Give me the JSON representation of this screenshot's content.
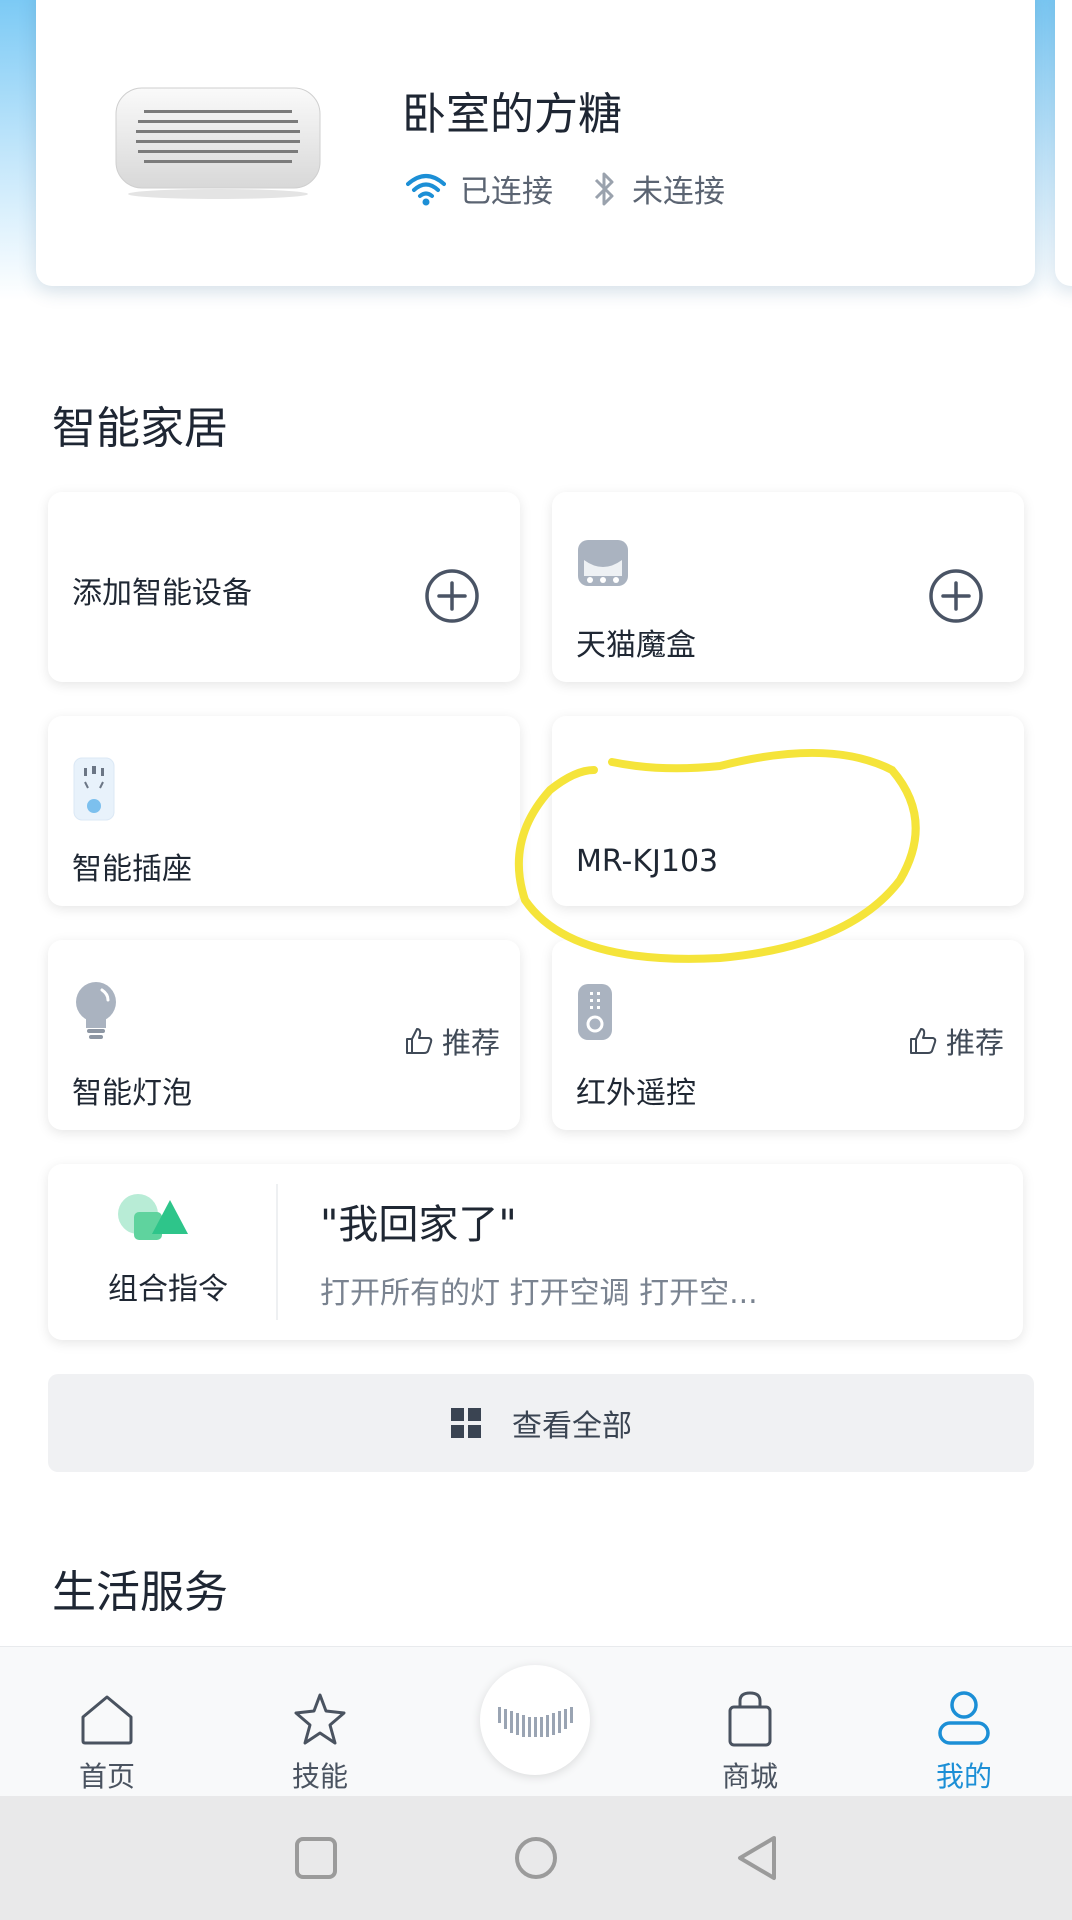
{
  "device": {
    "name": "卧室的方糖",
    "wifi_status": "已连接",
    "bluetooth_status": "未连接"
  },
  "smart_home": {
    "title": "智能家居",
    "tiles": [
      {
        "label": "添加智能设备"
      },
      {
        "label": "天猫魔盒"
      },
      {
        "label": "智能插座"
      },
      {
        "label": "MR-KJ103"
      },
      {
        "label": "智能灯泡",
        "badge": "推荐"
      },
      {
        "label": "红外遥控",
        "badge": "推荐"
      }
    ],
    "combo": {
      "label": "组合指令",
      "title": "\"我回家了\"",
      "desc": "打开所有的灯 打开空调 打开空..."
    },
    "view_all": "查看全部"
  },
  "life_services": {
    "title": "生活服务"
  },
  "tabbar": {
    "items": [
      {
        "label": "首页",
        "icon": "home-icon"
      },
      {
        "label": "技能",
        "icon": "star-icon"
      },
      {
        "label": "",
        "icon": "voice-icon"
      },
      {
        "label": "商城",
        "icon": "bag-icon"
      },
      {
        "label": "我的",
        "icon": "user-icon"
      }
    ],
    "active_color": "#1c8fd6"
  },
  "annotation": {
    "color": "#f5e43a",
    "note": "hand-drawn circle around MR-KJ103"
  }
}
